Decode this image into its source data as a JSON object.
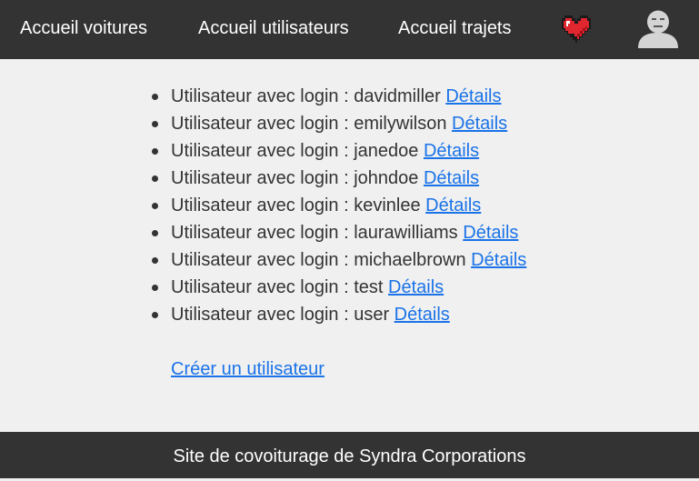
{
  "nav": {
    "links": [
      {
        "label": "Accueil voitures"
      },
      {
        "label": "Accueil utilisateurs"
      },
      {
        "label": "Accueil trajets"
      }
    ],
    "favorites_icon": "heart-icon",
    "profile_icon": "user-avatar-icon"
  },
  "users": {
    "prefix": "Utilisateur avec login : ",
    "details_label": "Détails",
    "items": [
      {
        "login": "davidmiller"
      },
      {
        "login": "emilywilson"
      },
      {
        "login": "janedoe"
      },
      {
        "login": "johndoe"
      },
      {
        "login": "kevinlee"
      },
      {
        "login": "laurawilliams"
      },
      {
        "login": "michaelbrown"
      },
      {
        "login": "test"
      },
      {
        "login": "user"
      }
    ],
    "create_label": "Créer un utilisateur"
  },
  "footer": {
    "text": "Site de covoiturage de Syndra Corporations"
  },
  "colors": {
    "nav_bg": "#333333",
    "page_bg": "#f0f0f0",
    "link": "#1a73e8",
    "heart": "#e0262e"
  }
}
